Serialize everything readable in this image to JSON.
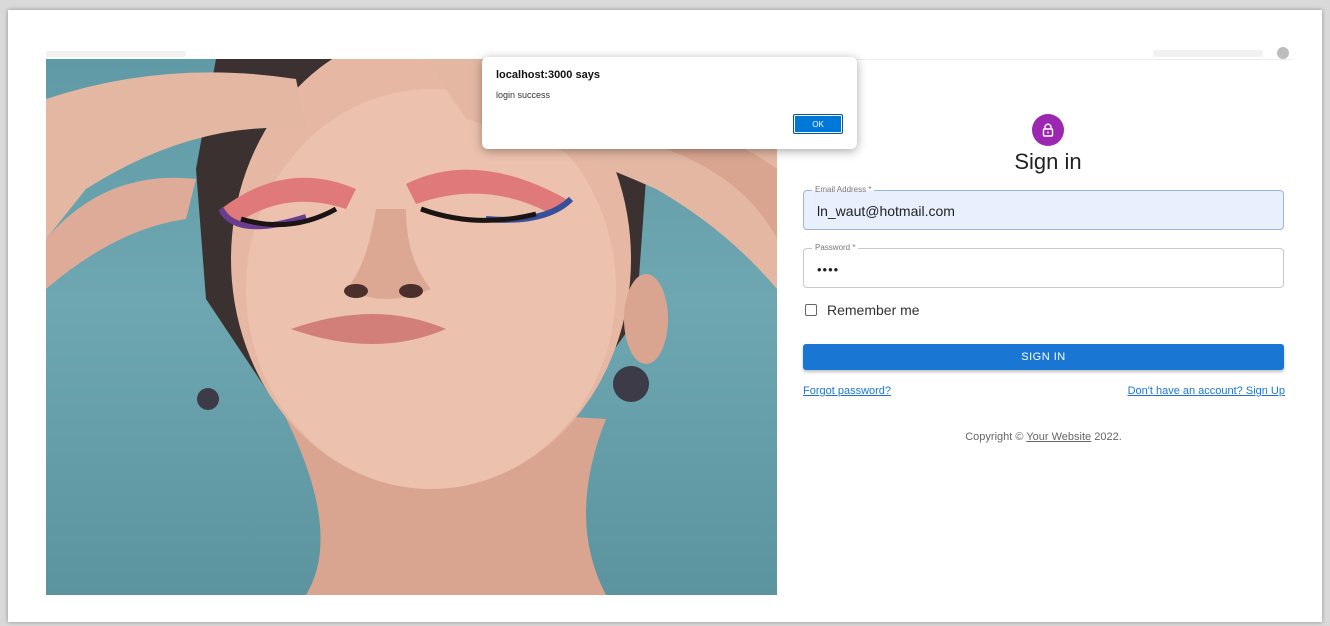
{
  "dialog": {
    "title": "localhost:3000 says",
    "message": "login success",
    "ok_label": "OK"
  },
  "signin": {
    "title": "Sign in",
    "email_label": "Email Address *",
    "email_value": "ln_waut@hotmail.com",
    "password_label": "Password *",
    "password_value": "••••",
    "remember_label": "Remember me",
    "submit_label": "SIGN IN",
    "forgot_link": "Forgot password?",
    "signup_link": "Don't have an account? Sign Up",
    "copyright_prefix": "Copyright ©",
    "copyright_link": "Your Website",
    "copyright_suffix": "2022."
  },
  "icons": {
    "avatar_icon": "lock-icon"
  },
  "colors": {
    "avatar": "#9c27b0",
    "primary": "#1976d2",
    "email_fill": "#e8f0fe",
    "dialog_button": "#0078d7"
  }
}
